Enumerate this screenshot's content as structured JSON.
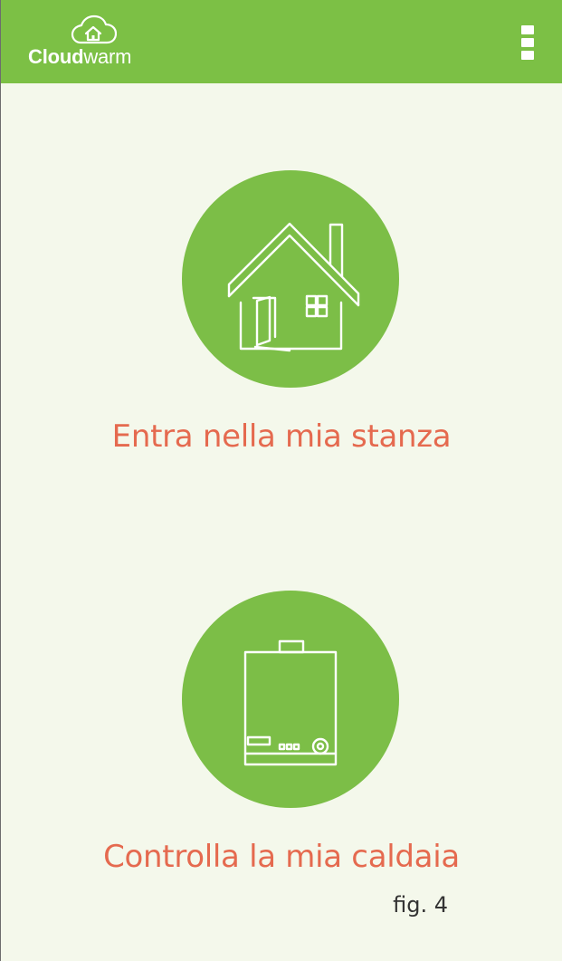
{
  "header": {
    "brand": {
      "strong": "Cloud",
      "light": "warm"
    },
    "icons": {
      "logo": "cloud-house-icon",
      "menu": "kebab-menu-icon"
    }
  },
  "main": {
    "actions": [
      {
        "label": "Entra nella mia stanza",
        "icon": "house-icon"
      },
      {
        "label": "Controlla la mia caldaia",
        "icon": "boiler-icon"
      }
    ]
  },
  "footer": {
    "figure_label": "fig. 4"
  },
  "colors": {
    "header_bg": "#7cc045",
    "page_bg": "#f4f8eb",
    "circle_bg": "#7cbe47",
    "label_accent": "#e56a4f"
  }
}
